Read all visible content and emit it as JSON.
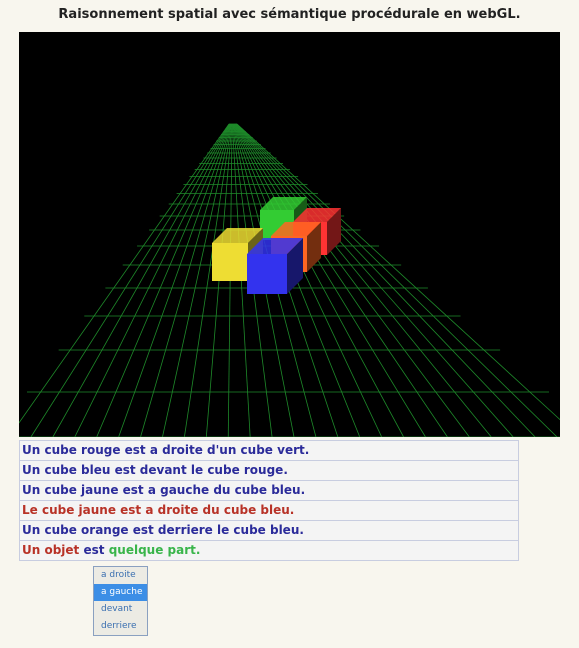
{
  "title": "Raisonnement spatial avec sémantique procédurale en webGL.",
  "scene": {
    "grid_color": "#1e8a2a",
    "cubes": [
      {
        "name": "cube-green",
        "color": "#33cc33"
      },
      {
        "name": "cube-red",
        "color": "#ff3333"
      },
      {
        "name": "cube-orange",
        "color": "#ff6622"
      },
      {
        "name": "cube-yellow",
        "color": "#eedd33"
      },
      {
        "name": "cube-blue",
        "color": "#3333ee"
      }
    ]
  },
  "sentences": [
    {
      "text": "Un cube rouge est a droite d'un cube vert.",
      "status": "true"
    },
    {
      "text": "Un cube bleu est devant le cube rouge.",
      "status": "true"
    },
    {
      "text": "Un cube jaune est a gauche du cube bleu.",
      "status": "true"
    },
    {
      "text": "Le cube jaune est a droite du cube bleu.",
      "status": "false"
    },
    {
      "text": "Un cube orange est derriere le cube bleu.",
      "status": "true"
    }
  ],
  "input_sentence": {
    "part1": "Un objet",
    "part2": "est",
    "part3": "quelque part."
  },
  "dropdown": {
    "options": [
      "a droite",
      "a gauche",
      "devant",
      "derriere"
    ],
    "selected": "a gauche"
  },
  "colors": {
    "true_text": "#2b2b9a",
    "false_text": "#b83227",
    "placeholder_text": "#39b54a",
    "selected_option": "#3c8ee6"
  }
}
